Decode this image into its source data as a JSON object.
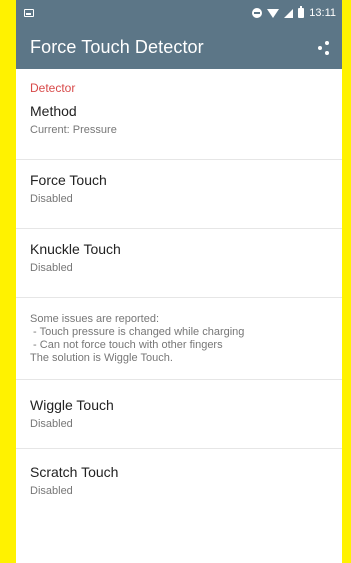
{
  "status_bar": {
    "time": "13:11",
    "icons": [
      "notification-icon",
      "do-not-disturb-icon",
      "wifi-icon",
      "signal-icon",
      "battery-icon"
    ]
  },
  "app_bar": {
    "title": "Force Touch Detector",
    "action_icon": "share-icon"
  },
  "section": {
    "header": "Detector"
  },
  "preferences": [
    {
      "title": "Method",
      "summary": "Current: Pressure"
    },
    {
      "title": "Force Touch",
      "summary": "Disabled"
    },
    {
      "title": "Knuckle Touch",
      "summary": "Disabled"
    }
  ],
  "info": {
    "lines": [
      "Some issues are reported:",
      " - Touch pressure is changed while charging",
      " - Can not force touch with other fingers",
      "The solution is Wiggle Touch."
    ]
  },
  "preferences_lower": [
    {
      "title": "Wiggle Touch",
      "summary": "Disabled"
    },
    {
      "title": "Scratch Touch",
      "summary": "Disabled"
    }
  ],
  "colors": {
    "background_frame": "#fff200",
    "primary": "#5c7687",
    "accent": "#d84a4a"
  }
}
